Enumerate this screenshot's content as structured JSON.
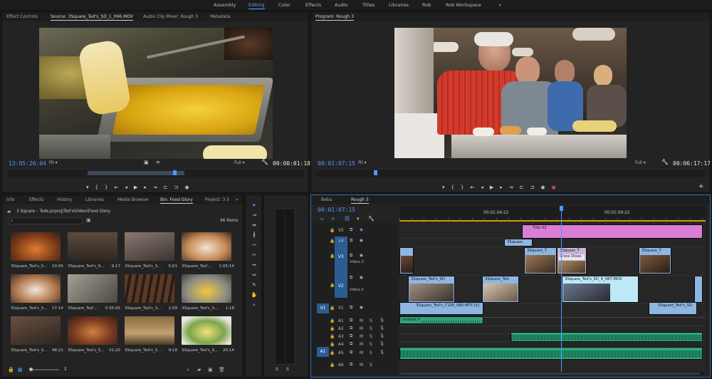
{
  "workspaces": [
    "Assembly",
    "Editing",
    "Color",
    "Effects",
    "Audio",
    "Titles",
    "Libraries",
    "Rob",
    "Rob Workspace"
  ],
  "workspaces_more": "»",
  "source_panel": {
    "tabs": [
      "Effect Controls",
      "Source: 3Square_Ted's_SD_1_066.MOV",
      "Audio Clip Mixer: Rough 3",
      "Metadata"
    ],
    "timecode_in": "13:05:26:04",
    "fit": "Fit",
    "quality": "Full",
    "timecode_duration": "00:00:01:18"
  },
  "program_panel": {
    "title": "Program: Rough 3",
    "timecode_in": "00:01:07:15",
    "fit": "Fit",
    "quality": "Full",
    "timecode_duration": "00:06:17:17"
  },
  "project_panel": {
    "tabs": [
      "Info",
      "Effects",
      "History",
      "Libraries",
      "Media Browser",
      "Bin: Food Glory",
      "Project: 3 S"
    ],
    "more": "»",
    "path": "3 Square – Teds.prproj\\Ted's\\Video\\Food Glory",
    "item_count": "46 Items",
    "items": [
      {
        "name": "3Square_Ted's_S...",
        "dur": "10:05"
      },
      {
        "name": "3Square_Ted's_S...",
        "dur": "9:17"
      },
      {
        "name": "3Square_Ted's_S...",
        "dur": "5:01"
      },
      {
        "name": "3Square_Ted'...",
        "dur": "1:05:14"
      },
      {
        "name": "3Square_Ted's_S...",
        "dur": "17:14"
      },
      {
        "name": "3Square_Ted'...",
        "dur": "3:35:06"
      },
      {
        "name": "3Square_Ted's_S...",
        "dur": "2:09"
      },
      {
        "name": "3Square_Ted's_S...",
        "dur": "1:18"
      },
      {
        "name": "3Square_Ted's_S...",
        "dur": "48:21"
      },
      {
        "name": "3Square_Ted's_S...",
        "dur": "31:20"
      },
      {
        "name": "3Square_Ted's_S...",
        "dur": "9:18"
      },
      {
        "name": "3Square_Ted's_S...",
        "dur": "20:14"
      }
    ]
  },
  "timeline": {
    "tabs": [
      "Beba",
      "Rough 3"
    ],
    "timecode": "00:01:07:15",
    "ruler_marks": [
      "00:01:04:22",
      "00:01:09:22"
    ],
    "video_tracks": [
      "V5",
      "V4",
      "V3",
      "V2",
      "V1"
    ],
    "track_names": {
      "v3": "Video 3",
      "v2": "Video 2"
    },
    "audio_tracks": [
      "A1",
      "A2",
      "A3",
      "A4",
      "A5",
      "A6"
    ],
    "source_video": "V1",
    "source_audio": "A1",
    "mute": "M",
    "solo": "S",
    "clips": {
      "title": "Title 02",
      "v4": "3Square",
      "v3a": "3Square_T",
      "v3b": "3Square_T",
      "v3c": "Cross Disso",
      "v3d": "3Square_T",
      "v2a": "3Square_Ted's_SD",
      "v2b": "3Square_Ted",
      "v2c": "3Square_Ted's_SD_4_087.MOV",
      "v1a": "3Square_Ted's_C100_080.MTS [V]",
      "v1b": "3Square_Ted's_SD",
      "a1": "onstant P"
    }
  },
  "meter": {
    "solo_left": "S",
    "solo_right": "S"
  },
  "colors": {
    "accent": "#4a9bff",
    "title_clip": "#d97ed4",
    "video_clip": "#8eb6e2",
    "audio_clip": "#2fa57d",
    "playhead": "#4a9bff"
  }
}
